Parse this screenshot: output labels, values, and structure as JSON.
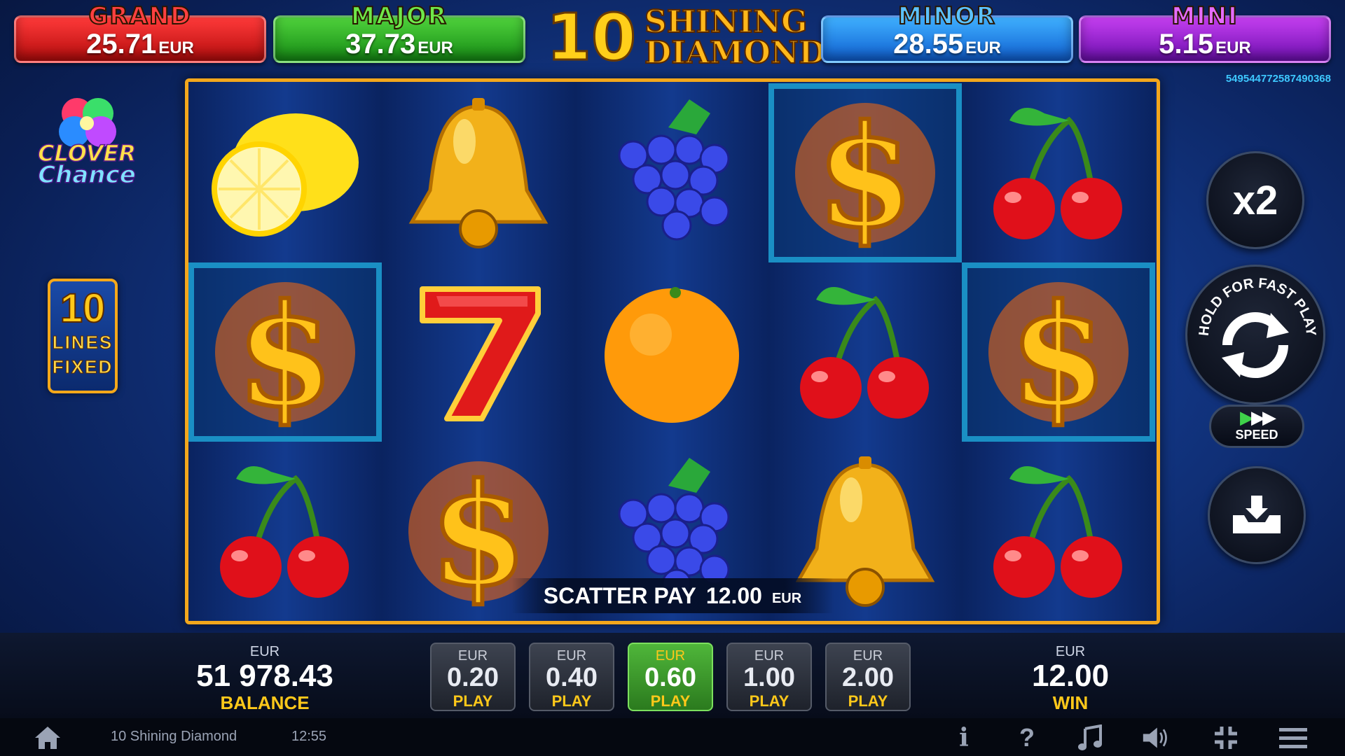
{
  "jackpots": [
    {
      "name": "GRAND",
      "value": "25.71",
      "currency": "EUR"
    },
    {
      "name": "MAJOR",
      "value": "37.73",
      "currency": "EUR"
    },
    {
      "name": "MINOR",
      "value": "28.55",
      "currency": "EUR"
    },
    {
      "name": "MINI",
      "value": "5.15",
      "currency": "EUR"
    }
  ],
  "logo": {
    "number": "10",
    "line1": "SHINING",
    "line2": "DIAMOND"
  },
  "game_id": "549544772587490368",
  "clover": {
    "line1": "CLOVER",
    "line2": "Chance"
  },
  "lines_badge": {
    "number": "10",
    "line1": "LINES",
    "line2": "FIXED"
  },
  "reels": [
    [
      "lemon",
      "dollar",
      "cherry"
    ],
    [
      "bell",
      "seven",
      "dollar"
    ],
    [
      "grapes",
      "orange",
      "grapes"
    ],
    [
      "dollar",
      "cherry",
      "bell"
    ],
    [
      "cherry",
      "dollar",
      "cherry"
    ]
  ],
  "highlighted_cells": [
    "1-0",
    "3-1",
    "0-3",
    "1-4"
  ],
  "scatter_pay": {
    "label": "SCATTER PAY",
    "amount": "12.00",
    "currency": "EUR"
  },
  "controls": {
    "multiplier": "x2",
    "hold_text": "HOLD FOR FAST PLAY",
    "speed_label": "SPEED",
    "icons": [
      "refresh-icon",
      "fast-forward-icon",
      "collect-icon"
    ]
  },
  "balance": {
    "currency": "EUR",
    "value": "51 978.43",
    "label": "BALANCE"
  },
  "win": {
    "currency": "EUR",
    "value": "12.00",
    "label": "WIN"
  },
  "bets": [
    {
      "currency": "EUR",
      "value": "0.20",
      "label": "PLAY",
      "active": false
    },
    {
      "currency": "EUR",
      "value": "0.40",
      "label": "PLAY",
      "active": false
    },
    {
      "currency": "EUR",
      "value": "0.60",
      "label": "PLAY",
      "active": true
    },
    {
      "currency": "EUR",
      "value": "1.00",
      "label": "PLAY",
      "active": false
    },
    {
      "currency": "EUR",
      "value": "2.00",
      "label": "PLAY",
      "active": false
    }
  ],
  "status_bar": {
    "title": "10 Shining Diamond",
    "time": "12:55",
    "info_glyph": "i",
    "help_glyph": "?"
  },
  "colors": {
    "frame": "#f3a71c",
    "accent_yellow": "#ffc81a",
    "active_bet": "#4fb63a",
    "game_id": "#3ec8ff"
  }
}
